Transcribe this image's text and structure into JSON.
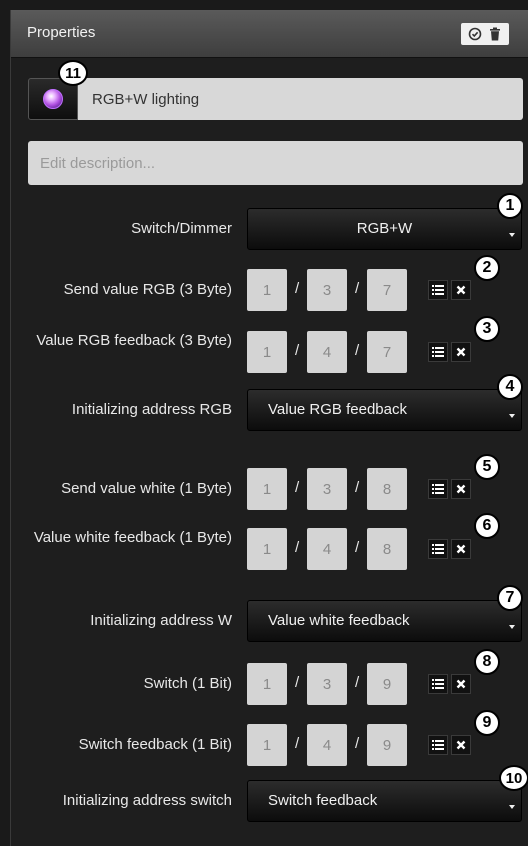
{
  "header": {
    "title": "Properties",
    "icons": [
      "check-circle-icon",
      "trash-icon"
    ]
  },
  "name_field": {
    "value": "RGB+W lighting"
  },
  "description_field": {
    "placeholder": "Edit description..."
  },
  "fields": [
    {
      "label": "Switch/Dimmer",
      "type": "dropdown",
      "value": "RGB+W",
      "badge": "1"
    },
    {
      "label": "Send value RGB (3 Byte)",
      "type": "address",
      "main": "1",
      "middle": "3",
      "sub": "7",
      "badge": "2"
    },
    {
      "label": "Value RGB feedback (3 Byte)",
      "type": "address",
      "main": "1",
      "middle": "4",
      "sub": "7",
      "badge": "3"
    },
    {
      "label": "Initializing address RGB",
      "type": "dropdown",
      "value": "Value RGB feedback",
      "badge": "4"
    },
    {
      "label": "Send value white (1 Byte)",
      "type": "address",
      "main": "1",
      "middle": "3",
      "sub": "8",
      "badge": "5"
    },
    {
      "label": "Value white feedback (1 Byte)",
      "type": "address",
      "main": "1",
      "middle": "4",
      "sub": "8",
      "badge": "6"
    },
    {
      "label": "Initializing address W",
      "type": "dropdown",
      "value": "Value white feedback",
      "badge": "7"
    },
    {
      "label": "Switch (1 Bit)",
      "type": "address",
      "main": "1",
      "middle": "3",
      "sub": "9",
      "badge": "8"
    },
    {
      "label": "Switch feedback (1 Bit)",
      "type": "address",
      "main": "1",
      "middle": "4",
      "sub": "9",
      "badge": "9"
    },
    {
      "label": "Initializing address switch",
      "type": "dropdown",
      "value": "Switch feedback",
      "badge": "10"
    }
  ],
  "name_badge": "11",
  "separator": "/"
}
